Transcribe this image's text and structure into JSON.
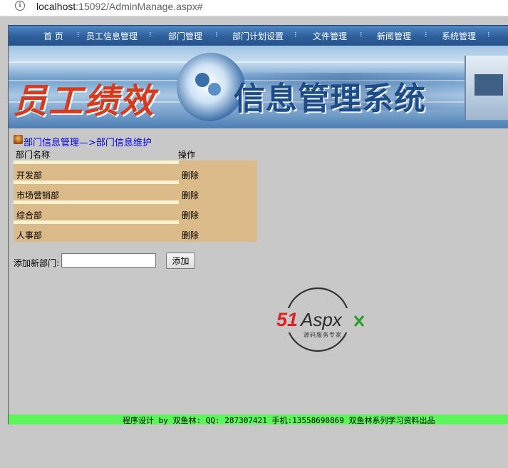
{
  "browser": {
    "url_host": "localhost",
    "url_rest": ":15092/AdminManage.aspx#"
  },
  "nav": {
    "items": [
      "首 页",
      "员工信息管理",
      "部门管理",
      "部门计划设置",
      "文件管理",
      "新闻管理",
      "系统管理"
    ],
    "separator": "⁝"
  },
  "banner": {
    "title_left": "员工绩效",
    "title_right": "信息管理系统"
  },
  "content": {
    "breadcrumb": "部门信息管理—>部门信息维护",
    "columns": [
      "部门名称",
      "操作"
    ],
    "rows": [
      {
        "name": "开发部",
        "action": "删除"
      },
      {
        "name": "市场营销部",
        "action": "删除"
      },
      {
        "name": "综合部",
        "action": "删除"
      },
      {
        "name": "人事部",
        "action": "删除"
      }
    ],
    "add_label": "添加新部门:",
    "add_input_value": "",
    "add_button": "添加"
  },
  "logo": {
    "text_51": "51",
    "text_aspx": "Aspx",
    "tagline": "源码服务专家"
  },
  "footer": {
    "text": "程序设计 by 双鱼林: QQ: 287307421 手机:13558690869 双鱼林系列学习资料出品"
  },
  "colors": {
    "nav_blue": "#2e5f9c",
    "grid_tan": "#dcbb8a",
    "footer_green": "#5cf55a",
    "link_blue": "#0000ee",
    "logo_red": "#e02020",
    "logo_green": "#2aa02a"
  }
}
